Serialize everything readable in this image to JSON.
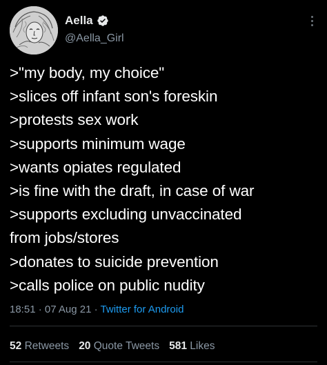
{
  "author": {
    "display_name": "Aella",
    "handle": "@Aella_Girl",
    "verified": true,
    "avatar_icon": "sketch-portrait-avatar"
  },
  "body_lines": [
    ">\"my body, my choice\"",
    ">slices off infant son's foreskin",
    ">protests sex work",
    ">supports minimum wage",
    ">wants opiates regulated",
    ">is fine with the draft, in case of war",
    ">supports excluding unvaccinated",
    "from jobs/stores",
    ">donates to suicide prevention",
    ">calls police on public nudity"
  ],
  "meta": {
    "time": "18:51",
    "separator": " · ",
    "date": "07 Aug 21",
    "source": "Twitter for Android"
  },
  "stats": {
    "retweets": {
      "count": "52",
      "label": "Retweets"
    },
    "quote_tweets": {
      "count": "20",
      "label": "Quote Tweets"
    },
    "likes": {
      "count": "581",
      "label": "Likes"
    }
  },
  "colors": {
    "background": "#000000",
    "text": "#e7e9ea",
    "secondary": "#8b98a5",
    "accent": "#1d9bf0",
    "divider": "#2f3336"
  }
}
